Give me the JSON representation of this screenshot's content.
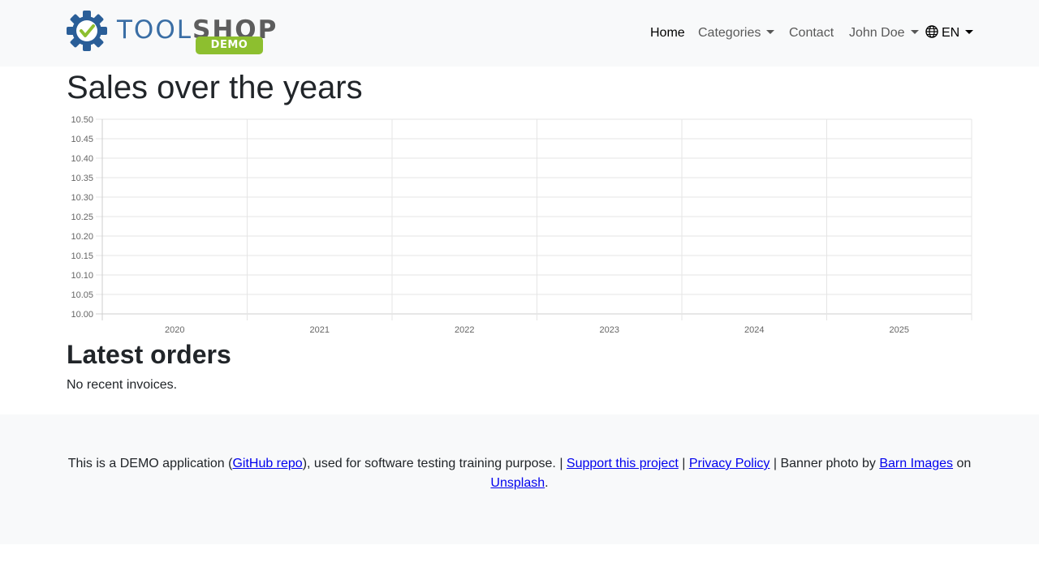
{
  "brand": {
    "tool": "TOOL",
    "shop": "SHOP",
    "badge": "DEMO",
    "colors": {
      "tool": "#3a6ea5",
      "shop": "#5d5d5d",
      "badge": "#8dbf2f",
      "gear": "#2a5e98",
      "check": "#8dbf2f"
    }
  },
  "nav": {
    "home": "Home",
    "categories": "Categories",
    "contact": "Contact",
    "user": "John Doe",
    "language": "EN",
    "language_icon": "globe-icon"
  },
  "page": {
    "title": "Sales over the years"
  },
  "chart_data": {
    "type": "line",
    "title": "",
    "xlabel": "",
    "ylabel": "",
    "categories": [
      "2020",
      "2021",
      "2022",
      "2023",
      "2024",
      "2025"
    ],
    "series": [],
    "ylim": [
      10.0,
      10.5
    ],
    "yticks": [
      "10.00",
      "10.05",
      "10.10",
      "10.15",
      "10.20",
      "10.25",
      "10.30",
      "10.35",
      "10.40",
      "10.45",
      "10.50"
    ],
    "grid": true,
    "legend": "none"
  },
  "orders": {
    "title": "Latest orders",
    "empty": "No recent invoices."
  },
  "footer": {
    "t1": "This is a DEMO application (",
    "github": "GitHub repo",
    "t2": "), used for software testing training purpose. | ",
    "support": "Support this project",
    "t3": " | ",
    "privacy": "Privacy Policy",
    "t4": " | Banner photo by ",
    "barn": "Barn Images",
    "t5": " on ",
    "unsplash": "Unsplash",
    "t6": "."
  }
}
